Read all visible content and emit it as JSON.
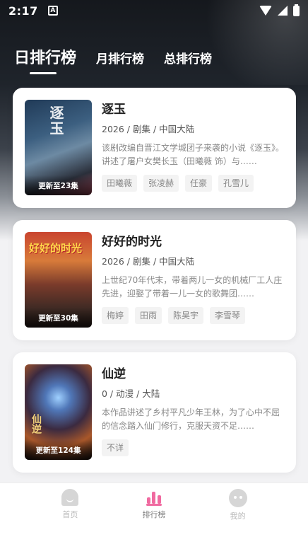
{
  "status_bar": {
    "time": "2:17",
    "notification_letter": "A"
  },
  "tabs": [
    {
      "label": "日排行榜"
    },
    {
      "label": "月排行榜"
    },
    {
      "label": "总排行榜"
    }
  ],
  "cards": [
    {
      "title": "逐玉",
      "meta": "2026 / 剧集 / 中国大陆",
      "description": "该剧改编自晋江文学城团子来袭的小说《逐玉》。讲述了屠户女樊长玉（田曦薇 饰）与……",
      "tags": [
        "田曦薇",
        "张凌赫",
        "任豪",
        "孔雪儿"
      ],
      "badge": "更新至23集",
      "poster_art_text": "逐玉"
    },
    {
      "title": "好好的时光",
      "meta": "2026 / 剧集 / 中国大陆",
      "description": "上世纪70年代末，带着两儿一女的机械厂工人庄先进，迎娶了带着一儿一女的歌舞团……",
      "tags": [
        "梅婷",
        "田雨",
        "陈昊宇",
        "李雪琴"
      ],
      "badge": "更新至30集",
      "poster_art_text": "好好的时光"
    },
    {
      "title": "仙逆",
      "meta": "0 / 动漫 / 大陆",
      "description": "本作品讲述了乡村平凡少年王林，为了心中不屈的信念踏入仙门修行，克服天资不足……",
      "tags": [
        "不详"
      ],
      "badge": "更新至124集",
      "poster_art_text": "仙逆"
    }
  ],
  "bottom_nav": [
    {
      "label": "首页",
      "icon": "home-icon"
    },
    {
      "label": "排行榜",
      "icon": "ranking-icon"
    },
    {
      "label": "我的",
      "icon": "profile-icon"
    }
  ],
  "colors": {
    "accent": "#f06aa0",
    "header_dark": "#15181d"
  }
}
